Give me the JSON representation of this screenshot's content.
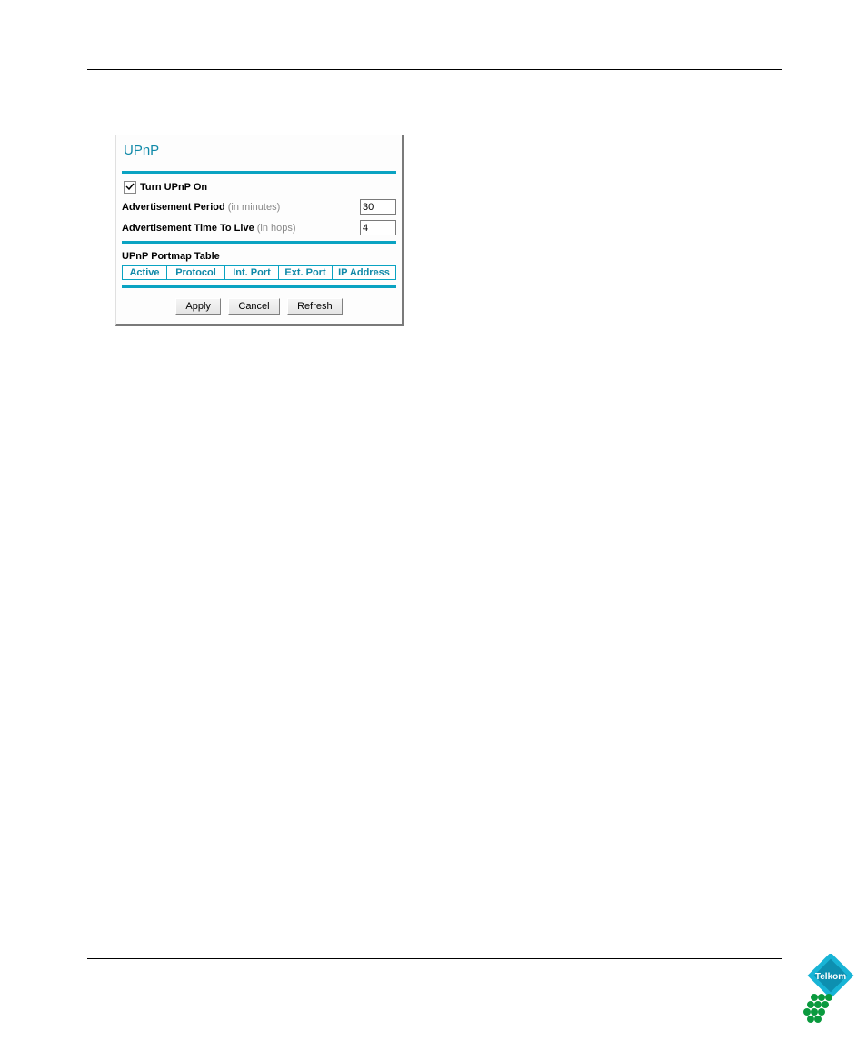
{
  "panel": {
    "title": "UPnP",
    "turn_on_label": "Turn UPnP On",
    "turn_on_checked": true,
    "ad_period_label": "Advertisement Period",
    "ad_period_hint": "(in minutes)",
    "ad_period_value": "30",
    "ad_ttl_label": "Advertisement Time To Live",
    "ad_ttl_hint": "(in hops)",
    "ad_ttl_value": "4",
    "portmap_title": "UPnP Portmap Table",
    "portmap_headers": {
      "active": "Active",
      "protocol": "Protocol",
      "int_port": "Int. Port",
      "ext_port": "Ext. Port",
      "ip_address": "IP Address"
    },
    "buttons": {
      "apply": "Apply",
      "cancel": "Cancel",
      "refresh": "Refresh"
    }
  },
  "logo": {
    "name": "Telkom"
  }
}
